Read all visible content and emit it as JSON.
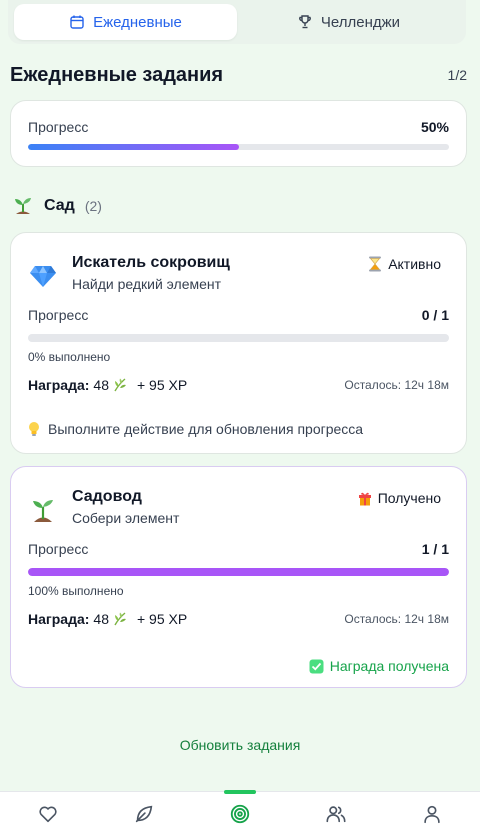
{
  "tabs": [
    {
      "label": "Ежедневные",
      "icon": "calendar-icon",
      "active": true
    },
    {
      "label": "Челленджи",
      "icon": "trophy-icon",
      "active": false
    }
  ],
  "header": {
    "title": "Ежедневные задания",
    "pager": "1/2"
  },
  "overall_progress": {
    "label": "Прогресс",
    "value_text": "50%",
    "fraction": 0.5
  },
  "section": {
    "title": "Сад",
    "count": "(2)",
    "icon": "sprout-icon"
  },
  "tasks": [
    {
      "icon": "gem-icon",
      "name": "Искатель сокровищ",
      "desc": "Найди редкий элемент",
      "status": "Активно",
      "status_icon": "hourglass-icon",
      "progress_label": "Прогресс",
      "progress_value": "0 / 1",
      "fraction": 0,
      "percent_text": "0% выполнено",
      "reward_label": "Награда:",
      "reward_amount": "48",
      "reward_xp": "+ 95 XP",
      "remaining": "Осталось: 12ч 18м",
      "hint": "Выполните действие для обновления прогресса"
    },
    {
      "icon": "sprout-icon",
      "name": "Садовод",
      "desc": "Собери элемент",
      "status": "Получено",
      "status_icon": "gift-icon",
      "progress_label": "Прогресс",
      "progress_value": "1 / 1",
      "fraction": 1,
      "percent_text": "100% выполнено",
      "reward_label": "Награда:",
      "reward_amount": "48",
      "reward_xp": "+ 95 XP",
      "remaining": "Осталось: 12ч 18м",
      "claimed_note": "Награда получена"
    }
  ],
  "refresh_label": "Обновить задания",
  "bottom_nav": [
    {
      "icon": "heart-icon",
      "active": false
    },
    {
      "icon": "leaf-icon",
      "active": false
    },
    {
      "icon": "target-icon",
      "active": true
    },
    {
      "icon": "users-icon",
      "active": false
    },
    {
      "icon": "user-icon",
      "active": false
    }
  ],
  "colors": {
    "accent_blue": "#2563eb",
    "accent_purple": "#a855f7",
    "accent_green": "#16a34a",
    "background": "#eef9ef"
  }
}
